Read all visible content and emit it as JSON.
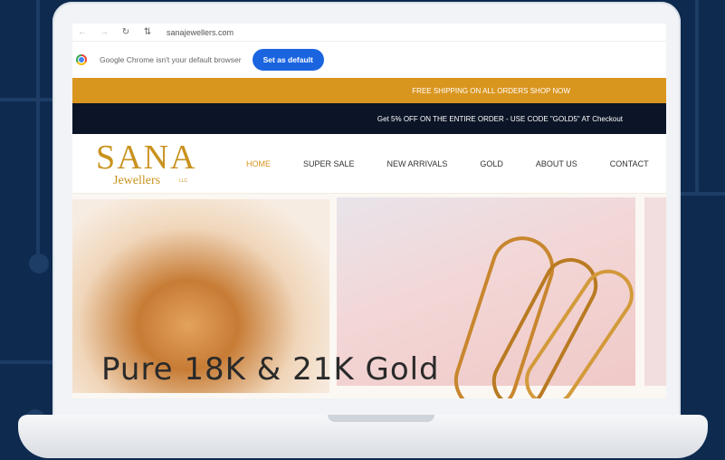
{
  "browser": {
    "url": "sanajewellers.com",
    "default_notice": "Google Chrome isn't your default browser",
    "set_default_label": "Set as default"
  },
  "site": {
    "shipping_banner": "FREE SHIPPING ON ALL ORDERS SHOP NOW",
    "promo_banner": "Get 5% OFF ON THE ENTIRE ORDER - USE CODE \"GOLD5\" AT Checkout",
    "logo": {
      "main": "SANA",
      "sub": "Jewellers",
      "suffix": "LLC"
    },
    "nav": [
      {
        "label": "HOME",
        "active": true
      },
      {
        "label": "SUPER SALE"
      },
      {
        "label": "NEW ARRIVALS"
      },
      {
        "label": "GOLD"
      },
      {
        "label": "ABOUT US"
      },
      {
        "label": "CONTACT"
      }
    ],
    "hero_title": "Pure 18K & 21K Gold"
  },
  "colors": {
    "brand_gold": "#c9921e",
    "shipping_bar": "#d9961f",
    "promo_bar": "#0c1527",
    "default_button": "#1a64e0",
    "background": "#0e2a4f"
  }
}
